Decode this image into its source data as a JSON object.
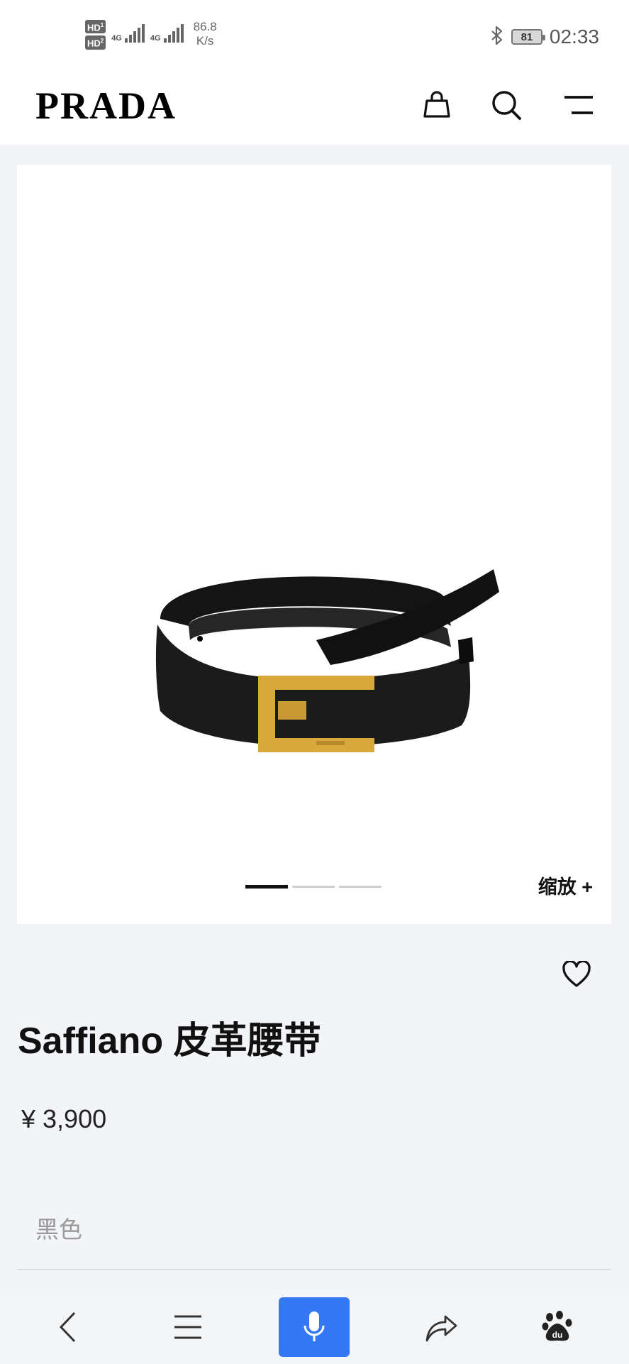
{
  "status_bar": {
    "sim1": "HD",
    "sim1_index": "1",
    "sim2": "HD",
    "sim2_index": "2",
    "network1": "4G",
    "network2": "4G",
    "speed_value": "86.8",
    "speed_unit": "K/s",
    "battery": "81",
    "time": "02:33"
  },
  "header": {
    "logo": "PRADA",
    "icons": [
      "shopping-bag-icon",
      "search-icon",
      "menu-icon"
    ]
  },
  "product": {
    "image_slide_count": 3,
    "active_slide": 1,
    "zoom_label": "缩放 +",
    "title": "Saffiano 皮革腰带",
    "price": "¥ 3,900",
    "color": "黑色"
  },
  "colors": {
    "accent_blue": "#3478f6",
    "belt_black": "#141414",
    "buckle_gold": "#d9a93c",
    "page_bg": "#f2f4f7"
  },
  "navbar": {
    "icons": [
      "back-icon",
      "menu-icon",
      "microphone-icon",
      "share-icon",
      "baidu-paw-icon"
    ]
  }
}
